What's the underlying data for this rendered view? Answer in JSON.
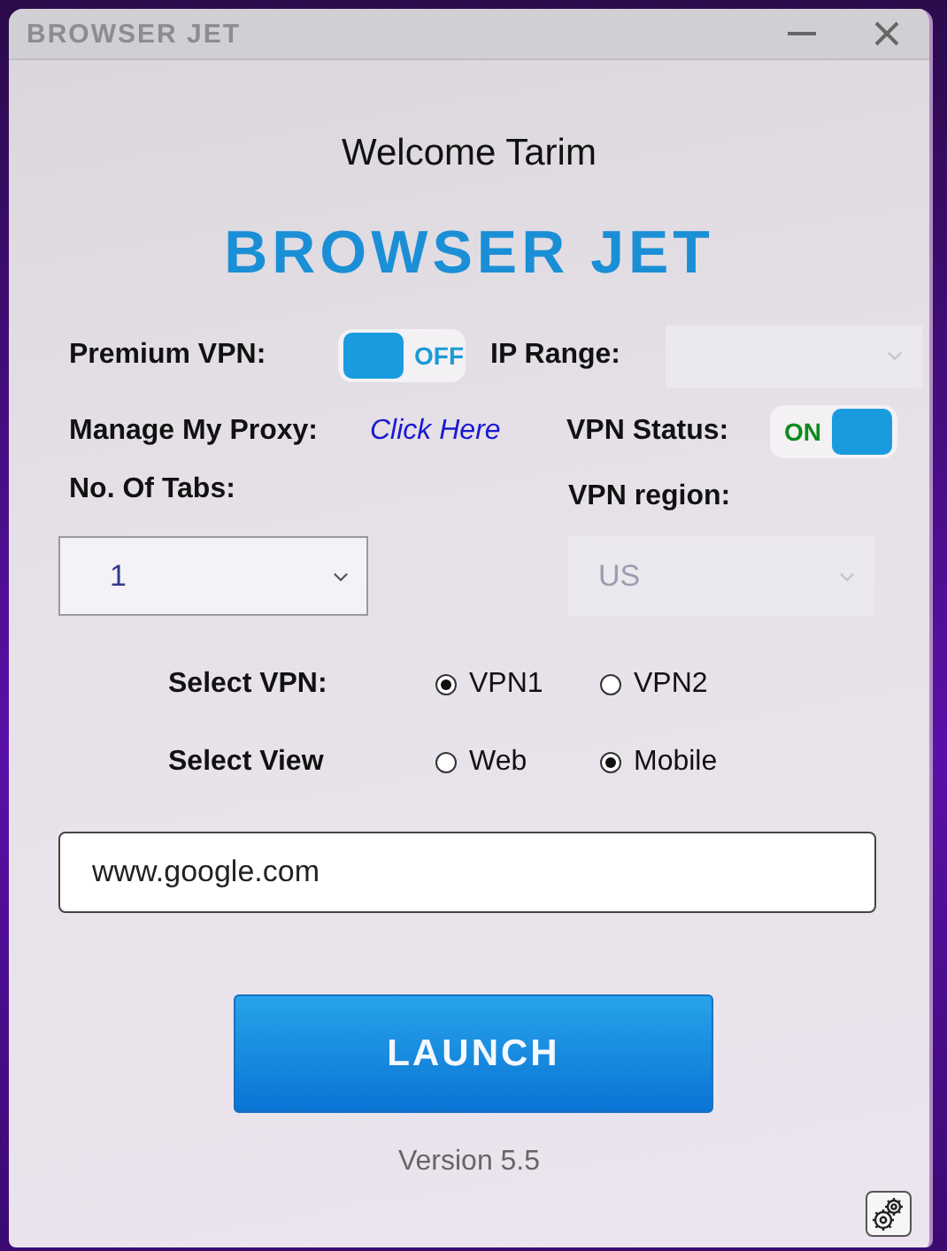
{
  "window": {
    "title": "BROWSER JET"
  },
  "welcome": "Welcome Tarim",
  "logo": "BROWSER JET",
  "premium_vpn": {
    "label": "Premium VPN:",
    "toggle": {
      "on": false,
      "text": "OFF"
    }
  },
  "ip_range": {
    "label": "IP Range:",
    "disabled": true
  },
  "manage_proxy": {
    "label": "Manage My Proxy:",
    "link": "Click Here"
  },
  "vpn_status": {
    "label": "VPN Status:",
    "toggle": {
      "on": true,
      "text": "ON"
    }
  },
  "tabs": {
    "label": "No. Of Tabs:",
    "value": "1",
    "disabled": false
  },
  "vpn_region": {
    "label": "VPN region:",
    "value": "US",
    "disabled": true
  },
  "select_vpn": {
    "label": "Select VPN:",
    "options": [
      {
        "label": "VPN1",
        "selected": true
      },
      {
        "label": "VPN2",
        "selected": false
      }
    ]
  },
  "select_view": {
    "label": "Select View",
    "options": [
      {
        "label": "Web",
        "selected": false
      },
      {
        "label": "Mobile",
        "selected": true
      }
    ]
  },
  "url": {
    "value": "www.google.com"
  },
  "launch": "LAUNCH",
  "version": "Version 5.5"
}
